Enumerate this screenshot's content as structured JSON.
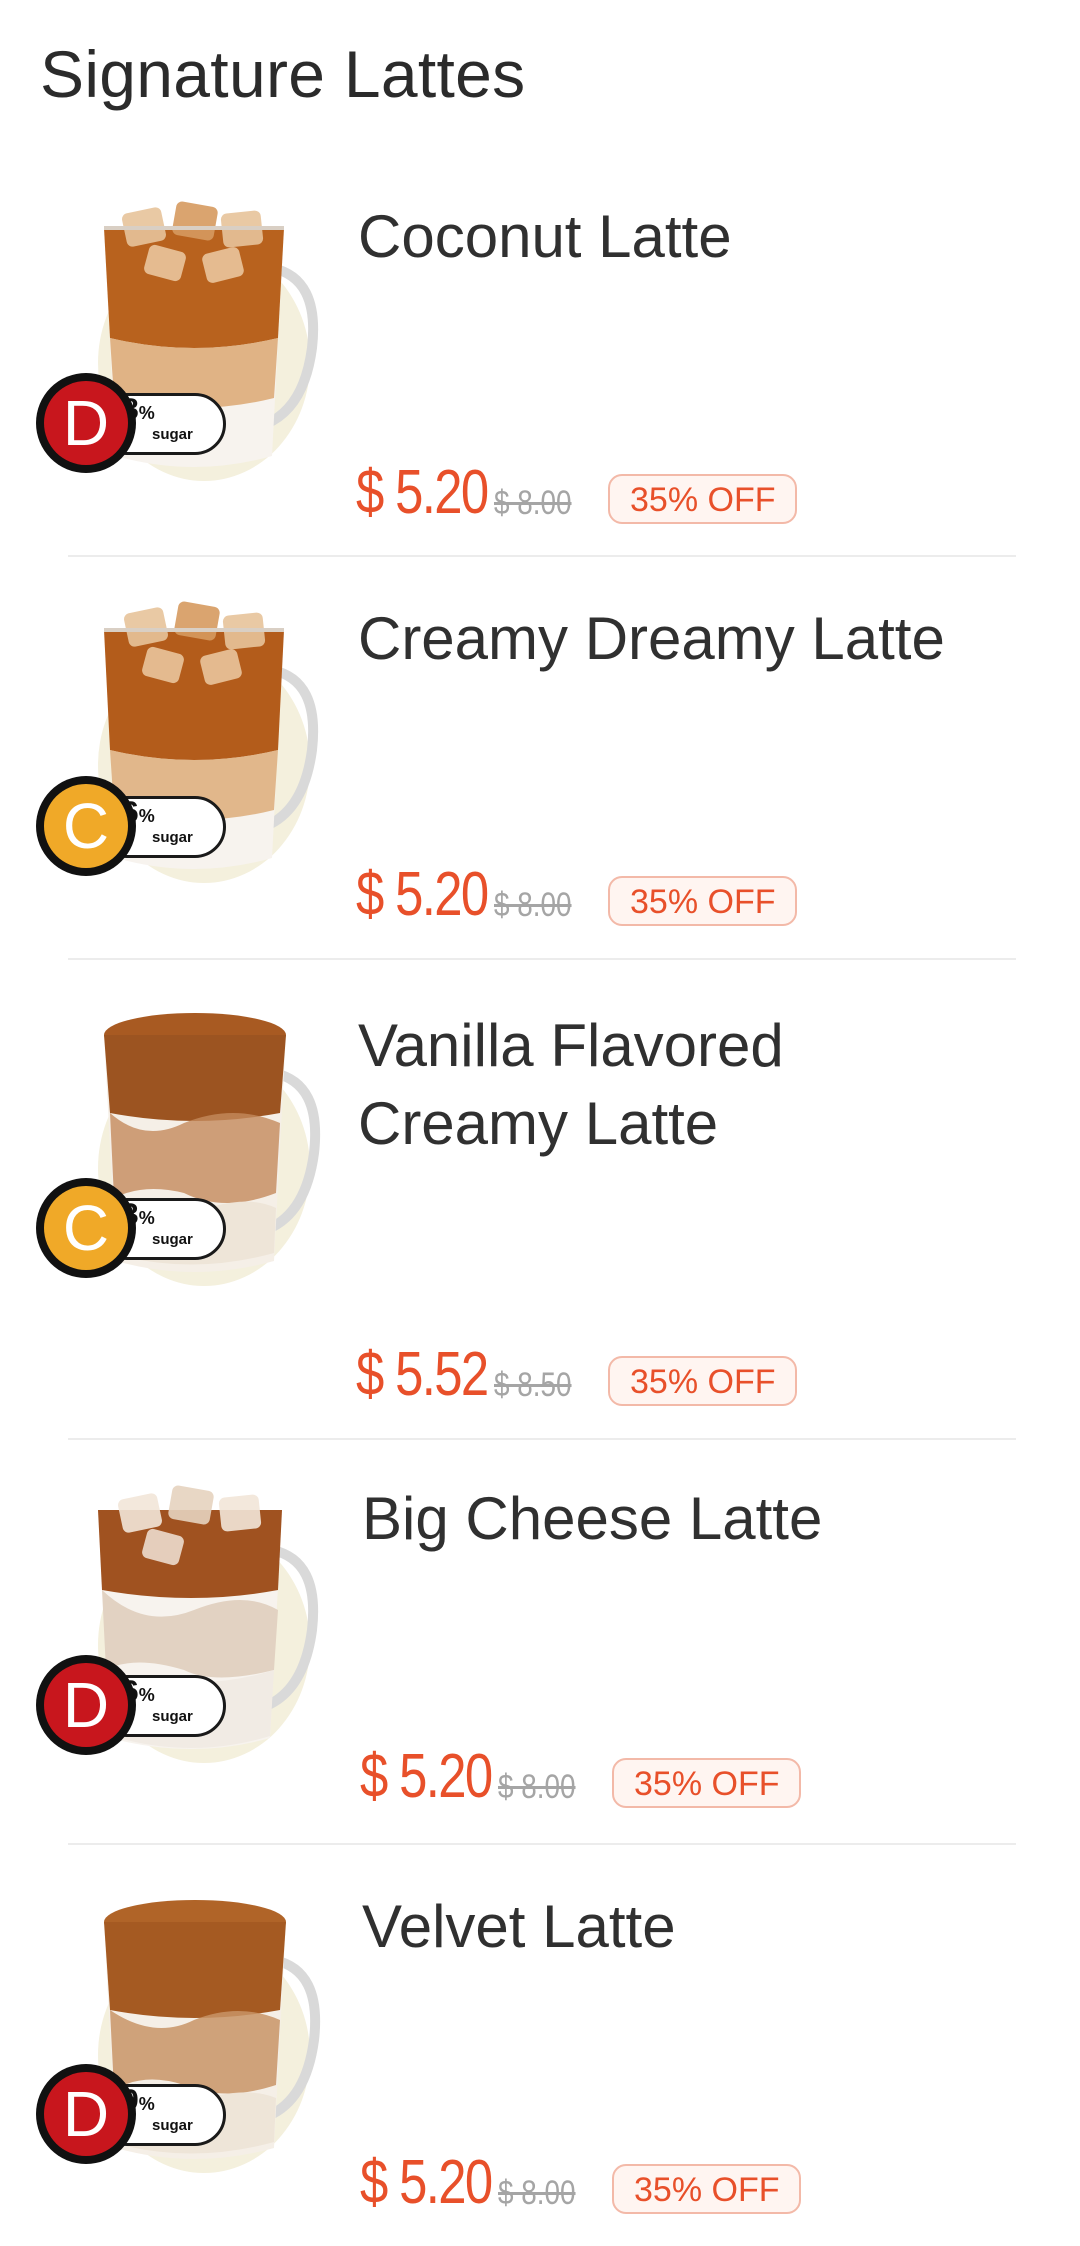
{
  "section": {
    "title": "Signature Lattes"
  },
  "items": [
    {
      "name": "Coconut Latte",
      "grade": "D",
      "sugar_pct": "8",
      "sugar_unit": "%",
      "sugar_label": "sugar",
      "price": "$ 5.20",
      "original_price": "$ 8.00",
      "discount": "35% OFF",
      "drink_style": "iced"
    },
    {
      "name": "Creamy Dreamy Latte",
      "grade": "C",
      "sugar_pct": "6",
      "sugar_unit": "%",
      "sugar_label": "sugar",
      "price": "$ 5.20",
      "original_price": "$ 8.00",
      "discount": "35% OFF",
      "drink_style": "iced"
    },
    {
      "name": "Vanilla Flavored Creamy Latte",
      "grade": "C",
      "sugar_pct": "3",
      "sugar_unit": "%",
      "sugar_label": "sugar",
      "price": "$ 5.52",
      "original_price": "$ 8.50",
      "discount": "35% OFF",
      "drink_style": "smooth"
    },
    {
      "name": "Big Cheese Latte",
      "grade": "D",
      "sugar_pct": "6",
      "sugar_unit": "%",
      "sugar_label": "sugar",
      "price": "$ 5.20",
      "original_price": "$ 8.00",
      "discount": "35% OFF",
      "drink_style": "iced"
    },
    {
      "name": "Velvet Latte",
      "grade": "D",
      "sugar_pct": "9",
      "sugar_unit": "%",
      "sugar_label": "sugar",
      "price": "$ 5.20",
      "original_price": "$ 8.00",
      "discount": "35% OFF",
      "drink_style": "smooth"
    }
  ],
  "colors": {
    "price": "#e8502a",
    "grade_D": "#c8161d",
    "grade_C": "#f0a928",
    "discount_bg": "#fff5f1",
    "discount_border": "#f3b9a8",
    "strike": "#a5a5a5"
  }
}
